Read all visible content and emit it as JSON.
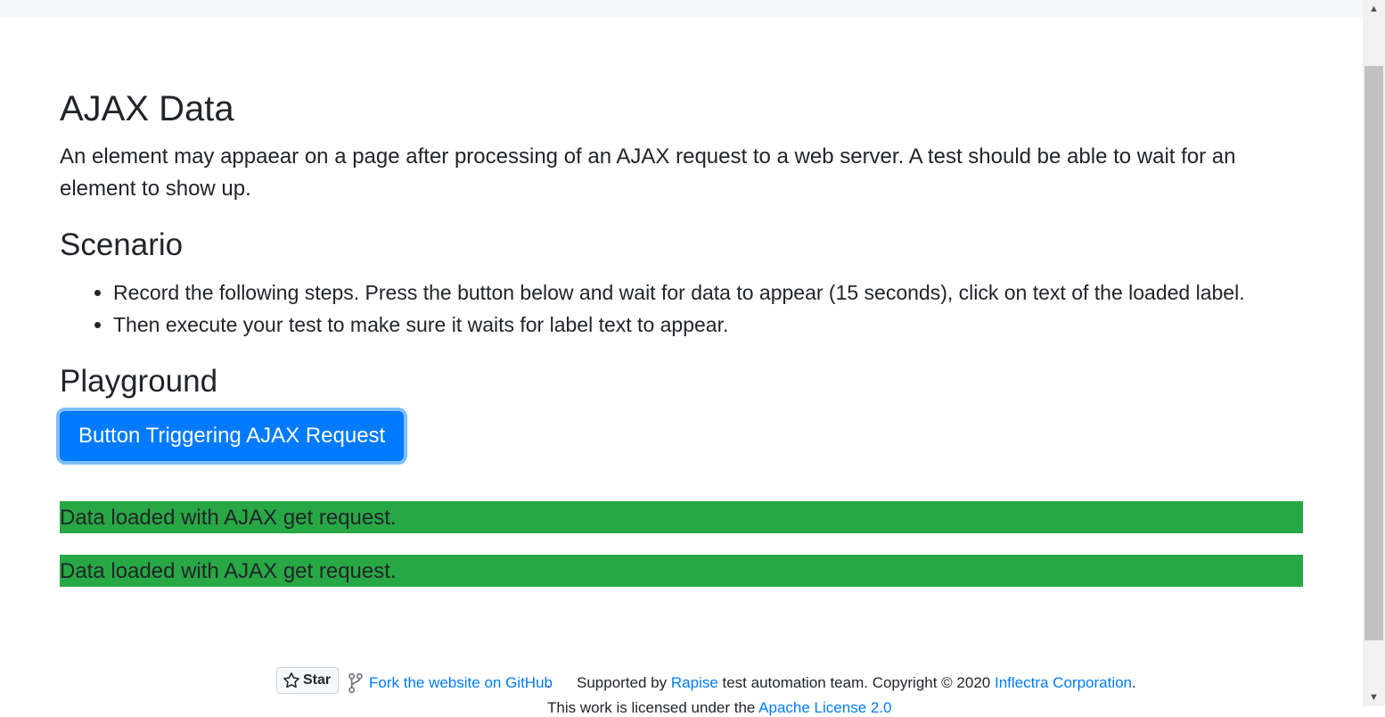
{
  "page": {
    "title": "AJAX Data",
    "description": "An element may appaear on a page after processing of an AJAX request to a web server. A test should be able to wait for an element to show up."
  },
  "scenario": {
    "heading": "Scenario",
    "steps": [
      "Record the following steps. Press the button below and wait for data to appear (15 seconds), click on text of the loaded label.",
      "Then execute your test to make sure it waits for label text to appear."
    ]
  },
  "playground": {
    "heading": "Playground",
    "button_label": "Button Triggering AJAX Request",
    "results": [
      "Data loaded with AJAX get request.",
      "Data loaded with AJAX get request."
    ]
  },
  "footer": {
    "star_label": "Star",
    "fork_link": "Fork the website on GitHub",
    "fork_period": ".",
    "supported_prefix": "Supported by ",
    "rapise_link": "Rapise",
    "supported_middle": " test automation team. Copyright © 2020 ",
    "inflectra_link": "Inflectra Corporation",
    "supported_suffix": ".",
    "license_prefix": "This work is licensed under the ",
    "license_link": "Apache License 2.0"
  },
  "colors": {
    "primary": "#007bff",
    "success": "#28a745",
    "text": "#212529",
    "link": "#007bff"
  },
  "icons": [
    "star-icon",
    "fork-icon",
    "scroll-up-arrow-icon",
    "scroll-down-arrow-icon"
  ]
}
